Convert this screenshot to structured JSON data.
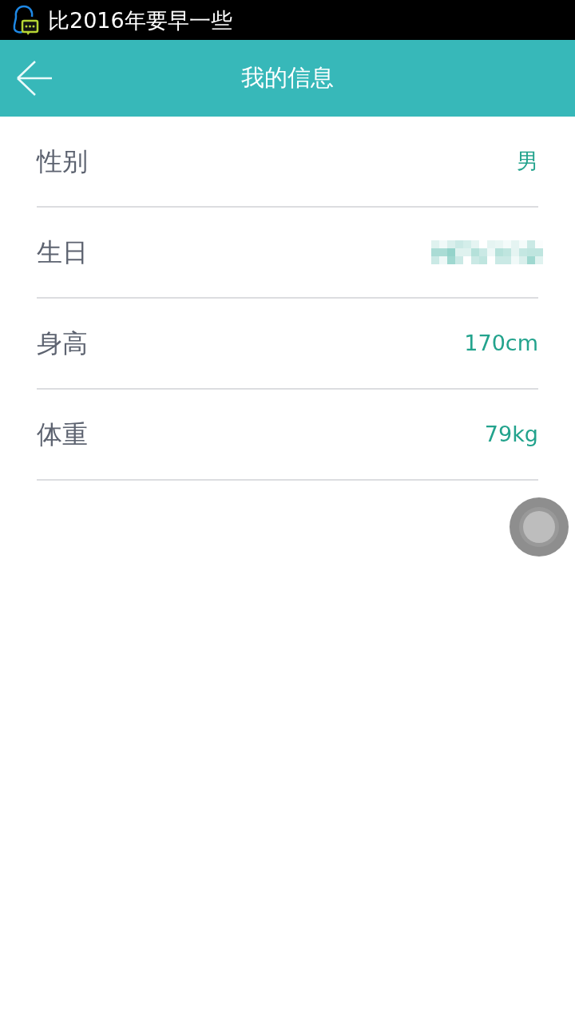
{
  "status_bar": {
    "notification": "比2016年要早一些"
  },
  "header": {
    "title": "我的信息"
  },
  "rows": [
    {
      "kind": "text",
      "label": "性别",
      "value": "男"
    },
    {
      "kind": "redacted",
      "label": "生日"
    },
    {
      "kind": "text",
      "label": "身高",
      "value": "170cm"
    },
    {
      "kind": "text",
      "label": "体重",
      "value": "79kg"
    }
  ]
}
